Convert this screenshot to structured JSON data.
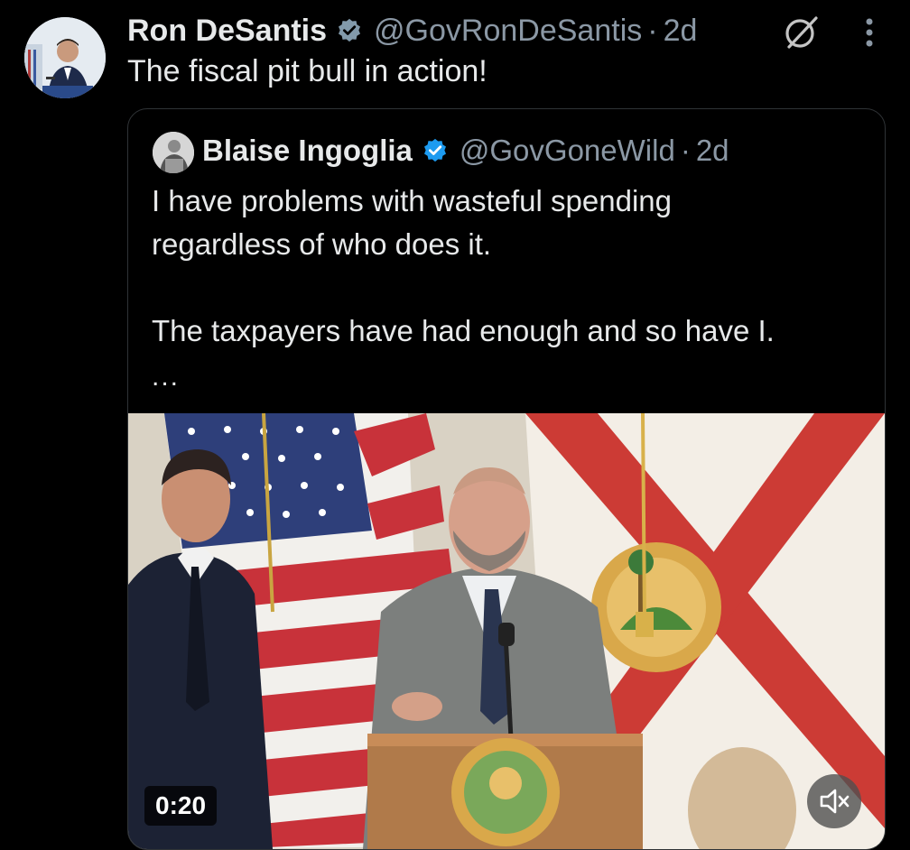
{
  "tweet": {
    "author_name": "Ron DeSantis",
    "author_handle": "@GovRonDeSantis",
    "separator": "·",
    "time": "2d",
    "text": "The fiscal pit bull in action!",
    "badge_color": "#829aab"
  },
  "quote": {
    "author_name": "Blaise Ingoglia",
    "author_handle": "@GovGoneWild",
    "separator": "·",
    "time": "2d",
    "lines": [
      "I have problems with wasteful spending",
      "regardless of who does it.",
      "",
      "The taxpayers have had enough and so have I."
    ],
    "more": "...",
    "badge_color": "#1d9bf0"
  },
  "video": {
    "duration": "0:20",
    "muted": true
  },
  "icons": {
    "grok": "grok-icon",
    "more": "more-options-icon",
    "mute": "speaker-muted-icon",
    "verified": "verified-badge-icon"
  }
}
